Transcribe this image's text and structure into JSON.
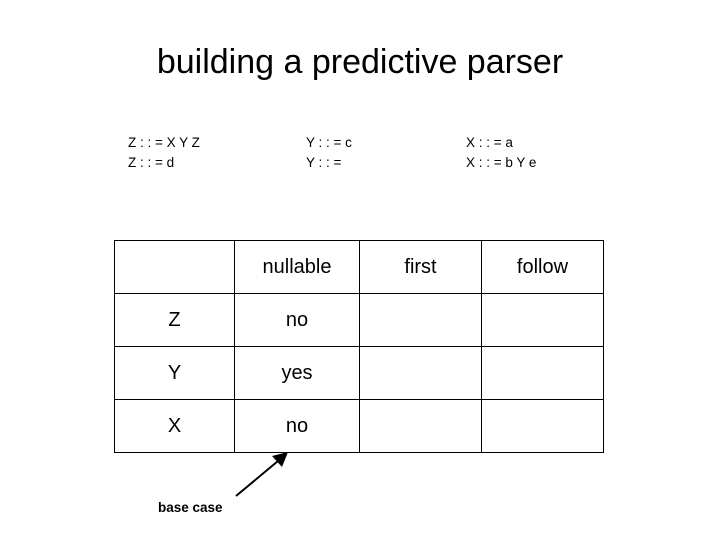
{
  "slide": {
    "title": "building a predictive parser",
    "grammar": [
      {
        "id": "rules-z",
        "text": "Z : : = X Y Z\nZ : : = d"
      },
      {
        "id": "rules-y",
        "text": "Y : : = c\nY : : ="
      },
      {
        "id": "rules-x",
        "text": "X : : = a\nX : : = b Y e"
      }
    ],
    "table": {
      "headers": [
        "",
        "nullable",
        "first",
        "follow"
      ],
      "rows": [
        {
          "symbol": "Z",
          "nullable": "no",
          "first": "",
          "follow": ""
        },
        {
          "symbol": "Y",
          "nullable": "yes",
          "first": "",
          "follow": ""
        },
        {
          "symbol": "X",
          "nullable": "no",
          "first": "",
          "follow": ""
        }
      ]
    },
    "annotation": {
      "label": "base case"
    },
    "colors": {
      "text": "#000000",
      "background": "#ffffff",
      "border": "#000000"
    }
  }
}
